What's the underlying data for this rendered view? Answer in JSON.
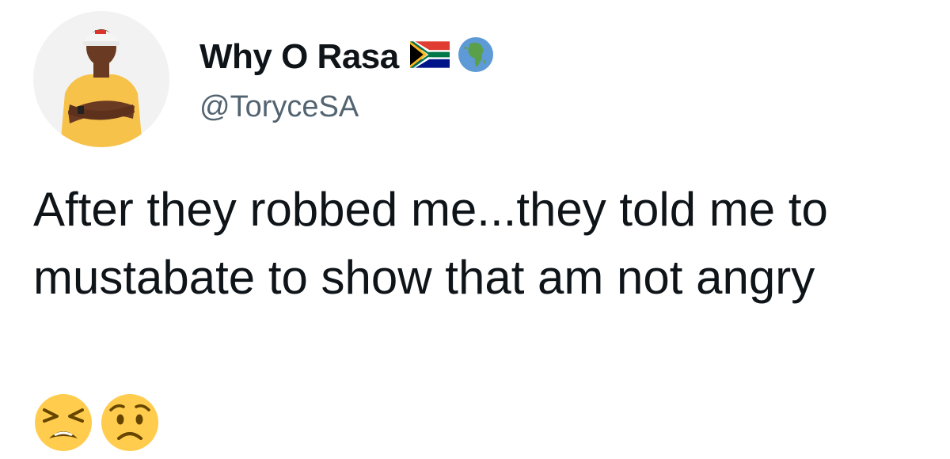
{
  "author": {
    "display_name": "Why O Rasa",
    "handle": "@ToryceSA",
    "avatar": "avatar-man-yellow-shirt-white-cap",
    "badges": [
      "south-africa-flag-icon",
      "globe-africa-icon"
    ]
  },
  "tweet": {
    "text": "After they robbed me...they told me to mustabate to show that am not angry",
    "emojis": [
      "tired-face-emoji",
      "worried-face-emoji"
    ]
  },
  "colors": {
    "text_primary": "#0f1419",
    "text_secondary": "#536471",
    "background": "#ffffff",
    "emoji_yellow": "#ffcc4d"
  }
}
